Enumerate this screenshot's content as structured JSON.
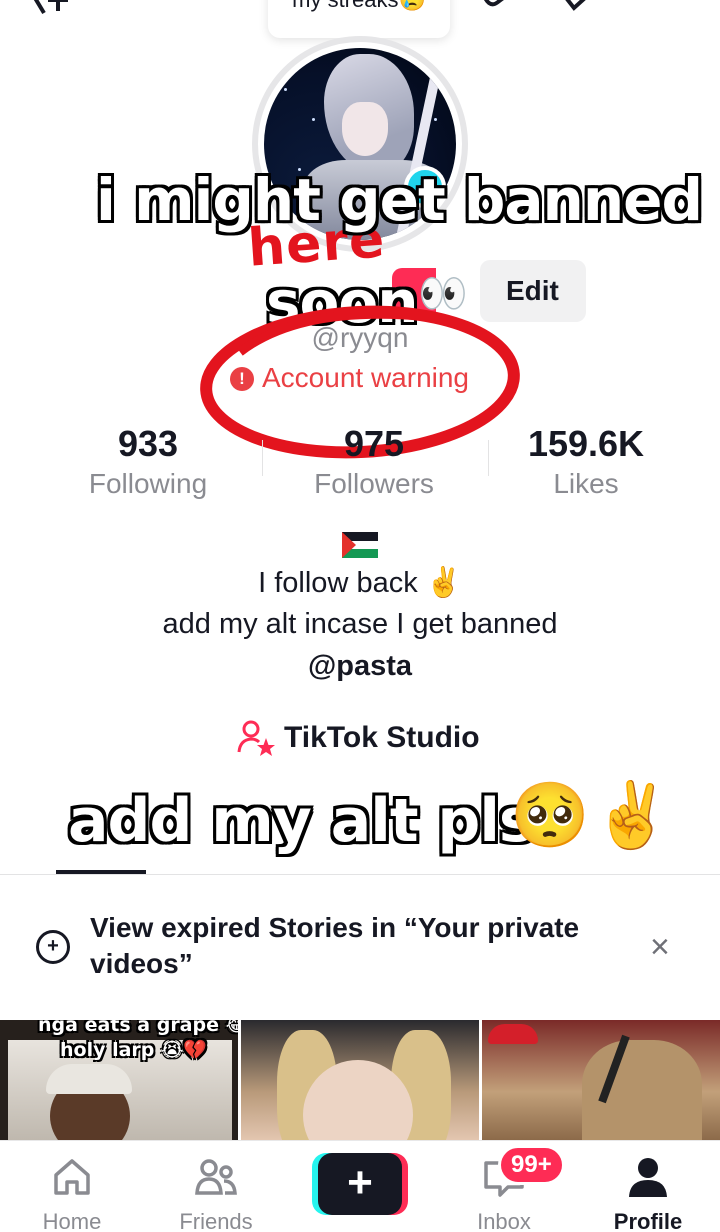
{
  "header": {
    "streaks_label": "my streaks😢"
  },
  "overlay_captions": {
    "line1": "i might get banned",
    "line2": "soon",
    "line3": "add my alt pls",
    "emoji_pleading": "🥺",
    "emoji_peace": "✌",
    "emoji_eyes": "👀",
    "drawn_word": "here"
  },
  "profile": {
    "edit_label": "Edit",
    "handle": "@ryyqn",
    "warning_label": "Account warning",
    "warning_glyph": "!",
    "stats": [
      {
        "value": "933",
        "label": "Following"
      },
      {
        "value": "975",
        "label": "Followers"
      },
      {
        "value": "159.6K",
        "label": "Likes"
      }
    ],
    "bio_line1": "I follow back ✌",
    "bio_line2": "add my alt incase I get banned",
    "bio_mention": "@pasta",
    "studio_label": "TikTok Studio"
  },
  "stories_banner": {
    "text": "View expired Stories in “Your private videos”",
    "close_glyph": "×"
  },
  "videos": [
    {
      "caption_line1": "nga eats a grape 😂",
      "caption_line2": "holy larp 😭💔"
    },
    {},
    {}
  ],
  "bottom_nav": {
    "items": [
      {
        "label": "Home"
      },
      {
        "label": "Friends"
      },
      {
        "label": ""
      },
      {
        "label": "Inbox",
        "badge": "99+"
      },
      {
        "label": "Profile"
      }
    ],
    "create_glyph": "+"
  },
  "colors": {
    "accent_red": "#fe2c55",
    "accent_cyan": "#25f4ee",
    "warning_red": "#ea4044",
    "text_secondary": "#8a8b91"
  },
  "icons": [
    "add-user-icon",
    "streak-icon",
    "pencil-icon",
    "menu-icon",
    "warning-icon",
    "studio-icon",
    "stories-icon",
    "close-icon",
    "home-icon",
    "friends-icon",
    "create-icon",
    "inbox-icon",
    "profile-icon"
  ]
}
